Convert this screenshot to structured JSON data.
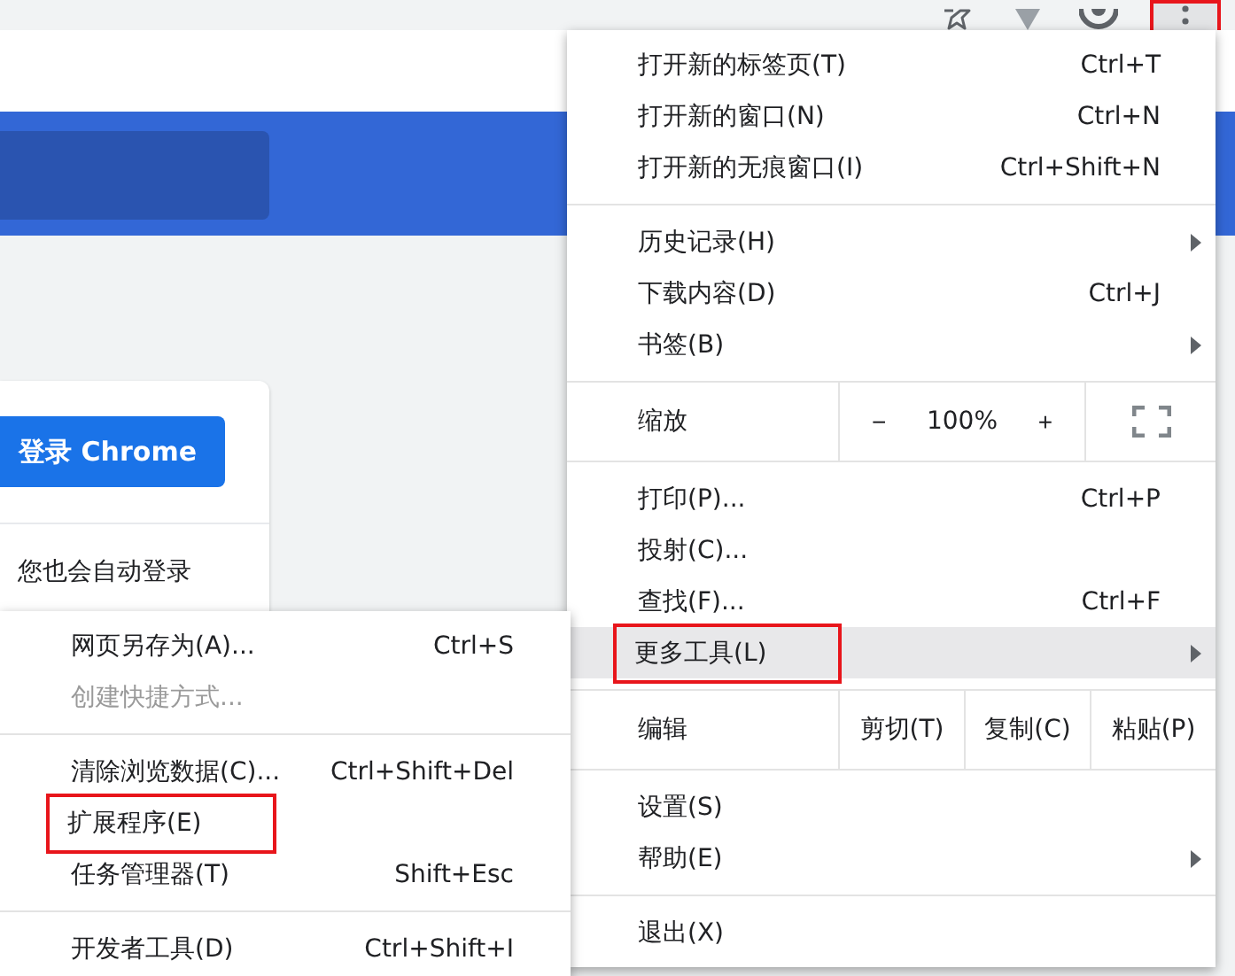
{
  "toolbar": {
    "menu_button": {
      "marked": true
    }
  },
  "page": {
    "sign_in_button": "登录 Chrome",
    "note": "您也会自动登录"
  },
  "main_menu": [
    {
      "kind": "item",
      "label": "打开新的标签页(T)",
      "shortcut": "Ctrl+T",
      "submenu": false,
      "hovered": false,
      "marked": false,
      "disabled": false
    },
    {
      "kind": "item",
      "label": "打开新的窗口(N)",
      "shortcut": "Ctrl+N",
      "submenu": false,
      "hovered": false,
      "marked": false,
      "disabled": false
    },
    {
      "kind": "item",
      "label": "打开新的无痕窗口(I)",
      "shortcut": "Ctrl+Shift+N",
      "submenu": false,
      "hovered": false,
      "marked": false,
      "disabled": false
    },
    {
      "kind": "divider"
    },
    {
      "kind": "item",
      "label": "历史记录(H)",
      "submenu": true,
      "hovered": false,
      "marked": false,
      "disabled": false
    },
    {
      "kind": "item",
      "label": "下载内容(D)",
      "shortcut": "Ctrl+J",
      "submenu": false,
      "hovered": false,
      "marked": false,
      "disabled": false
    },
    {
      "kind": "item",
      "label": "书签(B)",
      "submenu": true,
      "hovered": false,
      "marked": false,
      "disabled": false
    },
    {
      "kind": "divider"
    },
    {
      "kind": "zoom",
      "label": "缩放",
      "minus": "−",
      "value": "100%",
      "plus": "+"
    },
    {
      "kind": "divider"
    },
    {
      "kind": "item",
      "label": "打印(P)...",
      "shortcut": "Ctrl+P",
      "submenu": false,
      "hovered": false,
      "marked": false,
      "disabled": false
    },
    {
      "kind": "item",
      "label": "投射(C)...",
      "submenu": false,
      "hovered": false,
      "marked": false,
      "disabled": false
    },
    {
      "kind": "item",
      "label": "查找(F)...",
      "shortcut": "Ctrl+F",
      "submenu": false,
      "hovered": false,
      "marked": false,
      "disabled": false
    },
    {
      "kind": "item",
      "label": "更多工具(L)",
      "submenu": true,
      "hovered": true,
      "marked": true,
      "disabled": false
    },
    {
      "kind": "divider"
    },
    {
      "kind": "edit",
      "label": "编辑",
      "actions": [
        "剪切(T)",
        "复制(C)",
        "粘贴(P)"
      ]
    },
    {
      "kind": "divider"
    },
    {
      "kind": "item",
      "label": "设置(S)",
      "submenu": false,
      "hovered": false,
      "marked": false,
      "disabled": false
    },
    {
      "kind": "item",
      "label": "帮助(E)",
      "submenu": true,
      "hovered": false,
      "marked": false,
      "disabled": false
    },
    {
      "kind": "divider"
    },
    {
      "kind": "item",
      "label": "退出(X)",
      "submenu": false,
      "hovered": false,
      "marked": false,
      "disabled": false
    }
  ],
  "more_tools_menu": [
    {
      "kind": "item",
      "label": "网页另存为(A)...",
      "shortcut": "Ctrl+S",
      "submenu": false,
      "hovered": false,
      "marked": false,
      "disabled": false
    },
    {
      "kind": "item",
      "label": "创建快捷方式...",
      "submenu": false,
      "hovered": false,
      "marked": false,
      "disabled": true
    },
    {
      "kind": "divider"
    },
    {
      "kind": "item",
      "label": "清除浏览数据(C)...",
      "shortcut": "Ctrl+Shift+Del",
      "submenu": false,
      "hovered": false,
      "marked": false,
      "disabled": false
    },
    {
      "kind": "item",
      "label": "扩展程序(E)",
      "submenu": false,
      "hovered": false,
      "marked": true,
      "disabled": false
    },
    {
      "kind": "item",
      "label": "任务管理器(T)",
      "shortcut": "Shift+Esc",
      "submenu": false,
      "hovered": false,
      "marked": false,
      "disabled": false
    },
    {
      "kind": "divider"
    },
    {
      "kind": "item",
      "label": "开发者工具(D)",
      "shortcut": "Ctrl+Shift+I",
      "submenu": false,
      "hovered": false,
      "marked": false,
      "disabled": false
    }
  ]
}
